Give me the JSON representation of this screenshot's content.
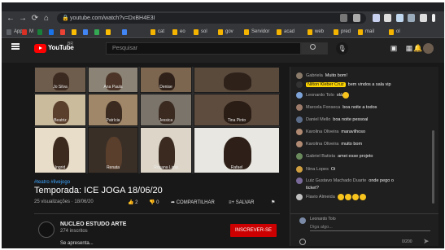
{
  "browser": {
    "url": "youtube.com/watch?v=DxBH4E3I",
    "bookmarks": [
      "Apps",
      "M",
      "",
      "",
      "",
      "",
      "",
      "",
      "",
      "",
      "cat",
      "eo",
      "sol",
      "gov",
      "Servidor",
      "acad",
      "web",
      "pred",
      "mail",
      "ol"
    ]
  },
  "youtube": {
    "logo_text": "YouTube",
    "country": "BR",
    "search_placeholder": "Pesquisar"
  },
  "player": {
    "tiles": [
      {
        "name": "Jo Silva\nCâmera Offline"
      },
      {
        "name": "Ana Paula\nCâmera Offline"
      },
      {
        "name": "Denise\nCâmera Offline"
      },
      {
        "name": ""
      },
      {
        "name": "Patrícia\nCâmera"
      },
      {
        "name": "Jessica\nCâmera Offline"
      },
      {
        "name": "Tina Pinto\nCâmera"
      },
      {
        "name": "Beatriz\nCâmera"
      },
      {
        "name": "Ingrid\nCâmera"
      },
      {
        "name": "Renata\nCâmera"
      },
      {
        "name": "Rosana Lima\nCâmera"
      },
      {
        "name": "Rafael"
      }
    ]
  },
  "video": {
    "tags": "#teatro #livejogo",
    "title": "Temporada: ICE JOGA 18/06/20",
    "meta": "25 visualizações · 18/06/20",
    "likes": "2",
    "dislikes": "0",
    "share_label": "COMPARTILHAR",
    "save_label": "SALVAR",
    "channel_name": "NUCLEO ESTUDO ARTE",
    "channel_subs": "274 inscritos",
    "channel_desc": "Se apresenta...",
    "subscribe_label": "INSCREVER-SE"
  },
  "chat": {
    "messages": [
      {
        "author": "Gabriela",
        "text": "Muito bom!",
        "highlight": false,
        "avatar_color": "#8a7a6a"
      },
      {
        "author": "Nilton Kleber Cruz",
        "text": "bem vindos a sala vip",
        "highlight": true,
        "avatar_color": "#333333"
      },
      {
        "author": "Leonardo Tolo",
        "text": "olá",
        "highlight": false,
        "avatar_color": "#7ea3d8",
        "emoji": 1
      },
      {
        "author": "Marcela Fonseca",
        "text": "boa noite a todos",
        "highlight": false,
        "avatar_color": "#9c7b6a"
      },
      {
        "author": "Daniel Mello",
        "text": "boa noite pessoal",
        "highlight": false,
        "avatar_color": "#5c6d8a"
      },
      {
        "author": "Karolina Oliveira",
        "text": "maravilhoso",
        "highlight": false,
        "avatar_color": "#b08a72"
      },
      {
        "author": "Karolina Oliveira",
        "text": "muito bom",
        "highlight": false,
        "avatar_color": "#b08a72"
      },
      {
        "author": "Gabriel Batista",
        "text": "amei esse projeto",
        "highlight": false,
        "avatar_color": "#6a8a5c"
      },
      {
        "author": "Nina Lopes",
        "text": "Oi",
        "highlight": false,
        "avatar_color": "#d0a040"
      },
      {
        "author": "Luiz Gustavo Machado Duarte",
        "text": "onde pego o",
        "highlight": false,
        "avatar_color": "#7a6a9a",
        "continuation": "ticket?"
      },
      {
        "author": "Flavio Almeida",
        "text": "",
        "highlight": false,
        "avatar_color": "#c0c0c0",
        "emoji": 4
      }
    ],
    "input_user": "Leonardo Tolo",
    "input_placeholder": "Diga algo...",
    "char_count": "0/200"
  }
}
